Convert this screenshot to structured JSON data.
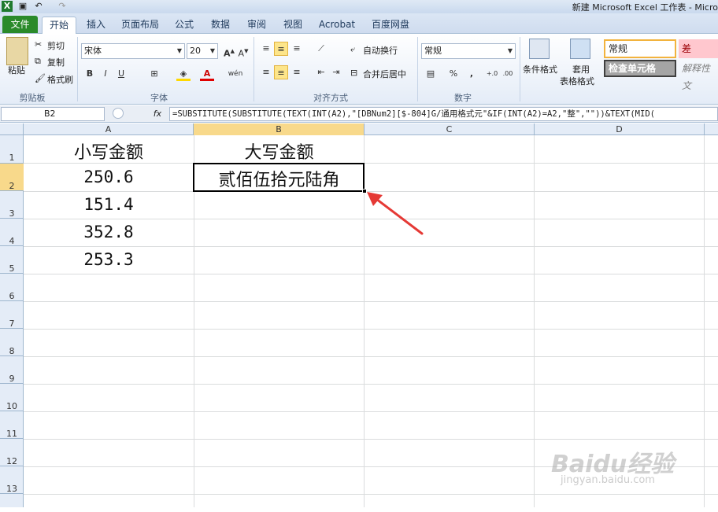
{
  "title_bar": {
    "app_title": "新建 Microsoft Excel 工作表 - Micro"
  },
  "tabs": [
    "文件",
    "开始",
    "插入",
    "页面布局",
    "公式",
    "数据",
    "审阅",
    "视图",
    "Acrobat",
    "百度网盘"
  ],
  "active_tab": "开始",
  "ribbon": {
    "clipboard": {
      "paste": "粘贴",
      "cut": "剪切",
      "copy": "复制",
      "format_painter": "格式刷",
      "label": "剪贴板"
    },
    "font": {
      "name": "宋体",
      "size": "20",
      "label": "字体",
      "phonetic_glyph": "wén"
    },
    "alignment": {
      "wrap_text": "自动换行",
      "merge_center": "合并后居中",
      "label": "对齐方式"
    },
    "number": {
      "format": "常规",
      "label": "数字"
    },
    "styles": {
      "conditional_format": "条件格式",
      "table_format_line1": "套用",
      "table_format_line2": "表格格式",
      "normal": "常规",
      "bad": "差",
      "check_cell": "检查单元格",
      "explanatory": "解释性文"
    }
  },
  "formula_bar": {
    "name_box": "B2",
    "fx": "fx",
    "formula": "=SUBSTITUTE(SUBSTITUTE(TEXT(INT(A2),\"[DBNum2][$-804]G/通用格式元\"&IF(INT(A2)=A2,\"整\",\"\"))&TEXT(MID("
  },
  "columns": [
    "A",
    "B",
    "C",
    "D"
  ],
  "active_column": "B",
  "rows": [
    "1",
    "2",
    "3",
    "4",
    "5",
    "6",
    "7",
    "8",
    "9",
    "10",
    "11",
    "12",
    "13"
  ],
  "active_row": "2",
  "cells": {
    "A1": "小写金额",
    "B1": "大写金额",
    "A2": "250.6",
    "B2": "贰佰伍拾元陆角",
    "A3": "151.4",
    "A4": "352.8",
    "A5": "253.3"
  },
  "watermark": {
    "brand": "Baidu经验",
    "url": "jingyan.baidu.com"
  },
  "colors": {
    "file_tab": "#2a8a2a",
    "selection_header": "#f8d98b",
    "annotation_arrow": "#e53935"
  }
}
